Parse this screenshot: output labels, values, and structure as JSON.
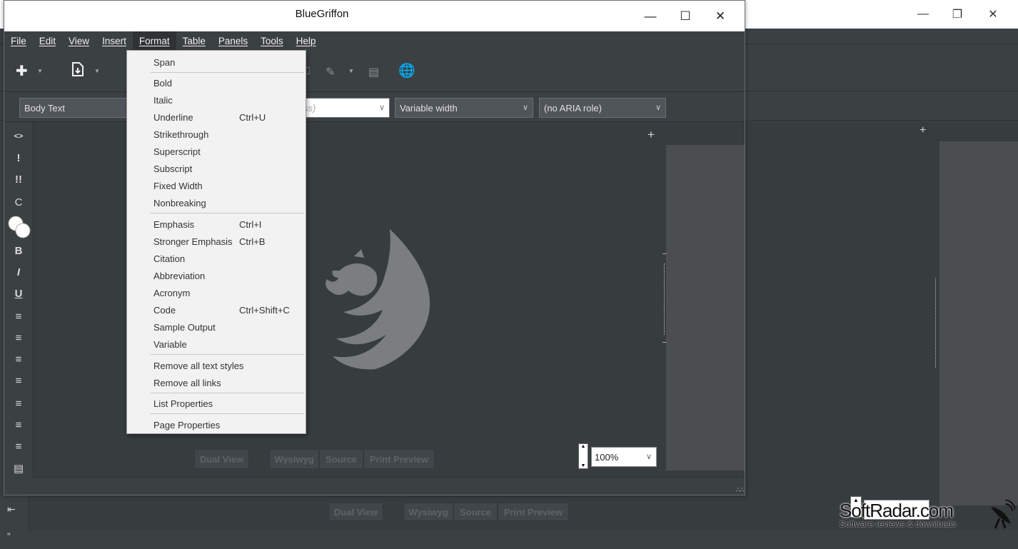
{
  "window": {
    "title": "BlueGriffon",
    "minimize_icon": "—",
    "maximize_icon": "☐",
    "close_icon": "✕"
  },
  "menubar": [
    {
      "label": "File"
    },
    {
      "label": "Edit"
    },
    {
      "label": "View"
    },
    {
      "label": "Insert"
    },
    {
      "label": "Format"
    },
    {
      "label": "Table"
    },
    {
      "label": "Panels"
    },
    {
      "label": "Tools"
    },
    {
      "label": "Help"
    }
  ],
  "formatbar": {
    "paragraph_style": "Body Text",
    "class_placeholder": "ss)",
    "width_mode": "Variable width",
    "aria_role": "(no ARIA role)"
  },
  "format_menu": {
    "items": [
      {
        "label": "Span",
        "shortcut": ""
      },
      {
        "label": "Bold",
        "shortcut": ""
      },
      {
        "label": "Italic",
        "shortcut": ""
      },
      {
        "label": "Underline",
        "shortcut": "Ctrl+U"
      },
      {
        "label": "Strikethrough",
        "shortcut": ""
      },
      {
        "label": "Superscript",
        "shortcut": ""
      },
      {
        "label": "Subscript",
        "shortcut": ""
      },
      {
        "label": "Fixed Width",
        "shortcut": ""
      },
      {
        "label": "Nonbreaking",
        "shortcut": ""
      },
      {
        "label": "Emphasis",
        "shortcut": "Ctrl+I"
      },
      {
        "label": "Stronger Emphasis",
        "shortcut": "Ctrl+B"
      },
      {
        "label": "Citation",
        "shortcut": ""
      },
      {
        "label": "Abbreviation",
        "shortcut": ""
      },
      {
        "label": "Acronym",
        "shortcut": ""
      },
      {
        "label": "Code",
        "shortcut": "Ctrl+Shift+C"
      },
      {
        "label": "Sample Output",
        "shortcut": ""
      },
      {
        "label": "Variable",
        "shortcut": ""
      },
      {
        "label": "Remove all text styles",
        "shortcut": ""
      },
      {
        "label": "Remove all links",
        "shortcut": ""
      },
      {
        "label": "List Properties",
        "shortcut": ""
      },
      {
        "label": "Page Properties",
        "shortcut": ""
      }
    ]
  },
  "view_modes": {
    "dual_view": "Dual View",
    "wysiwyg": "Wysiwyg",
    "source": "Source",
    "print_preview": "Print Preview"
  },
  "zoom": {
    "value": "100%"
  },
  "sidebar_icons": [
    "<>",
    "!",
    "!!",
    "C",
    "B",
    "I",
    "U"
  ],
  "watermark": {
    "title": "SoftRadar.com",
    "subtitle": "Software reviews & downloads"
  },
  "colors": {
    "window_bg": "#3b4043",
    "editor_bg": "#373c3f",
    "menu_bg": "#f2f2f2",
    "panel_bg": "#4a4e51"
  }
}
